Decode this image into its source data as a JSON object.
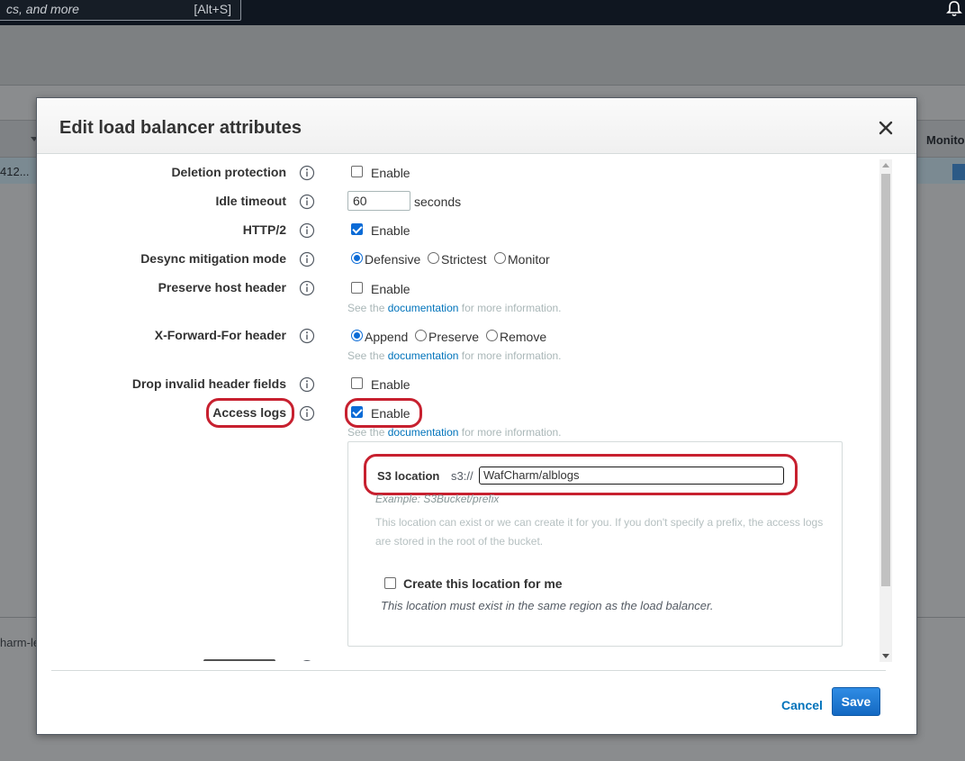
{
  "console": {
    "search_placeholder": "cs, and more",
    "search_shortcut": "[Alt+S]",
    "table_first_cell": "412...",
    "column_monitor": "Monito",
    "lower_row_text": "harm-le"
  },
  "modal": {
    "title": "Edit load balancer attributes",
    "fields": {
      "deletion_protection": {
        "label": "Deletion protection",
        "option": "Enable",
        "checked": false
      },
      "idle_timeout": {
        "label": "Idle timeout",
        "value": "60",
        "unit": "seconds"
      },
      "http2": {
        "label": "HTTP/2",
        "option": "Enable",
        "checked": true
      },
      "desync": {
        "label": "Desync mitigation mode",
        "options": [
          "Defensive",
          "Strictest",
          "Monitor"
        ],
        "selected": "Defensive"
      },
      "preserve_host": {
        "label": "Preserve host header",
        "option": "Enable",
        "checked": false,
        "hint_prefix": "See the",
        "hint_link": "documentation",
        "hint_suffix": "for more information."
      },
      "x_forward_for": {
        "label": "X-Forward-For header",
        "options": [
          "Append",
          "Preserve",
          "Remove"
        ],
        "selected": "Append",
        "hint_prefix": "See the",
        "hint_link": "documentation",
        "hint_suffix": "for more information."
      },
      "drop_invalid": {
        "label": "Drop invalid header fields",
        "option": "Enable",
        "checked": false
      },
      "access_logs": {
        "label": "Access logs",
        "option": "Enable",
        "checked": true,
        "hint_prefix": "See the",
        "hint_link": "documentation",
        "hint_suffix": "for more information."
      }
    },
    "s3": {
      "label": "S3 location",
      "prefix": "s3://",
      "value": "WafCharm/alblogs",
      "example": "Example: S3Bucket/prefix",
      "description": "This location can exist or we can create it for you. If you don't specify a prefix, the access logs are stored in the root of the bucket.",
      "create_label": "Create this location for me",
      "create_checked": false,
      "create_note": "This location must exist in the same region as the load balancer."
    },
    "footer": {
      "cancel": "Cancel",
      "save": "Save"
    }
  },
  "colors": {
    "accent": "#0073bb",
    "highlight": "#c7202f",
    "save_button": "#1469c2"
  }
}
